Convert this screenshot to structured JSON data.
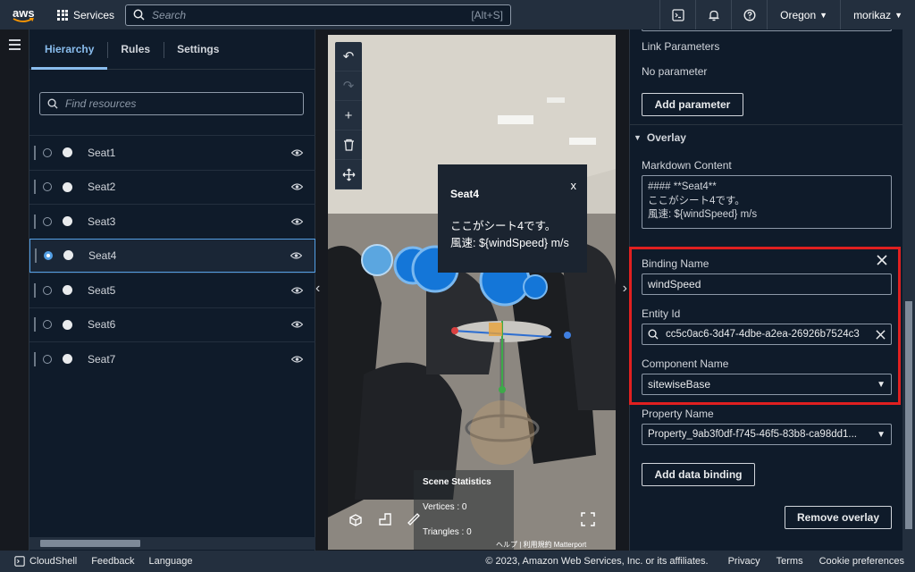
{
  "topbar": {
    "logo": "aws",
    "services_label": "Services",
    "search_placeholder": "Search",
    "search_shortcut": "[Alt+S]",
    "region": "Oregon",
    "user": "morikaz"
  },
  "hierarchy": {
    "tabs": [
      {
        "label": "Hierarchy",
        "active": true
      },
      {
        "label": "Rules",
        "active": false
      },
      {
        "label": "Settings",
        "active": false
      }
    ],
    "find_placeholder": "Find resources",
    "items": [
      {
        "label": "Seat1",
        "selected": false
      },
      {
        "label": "Seat2",
        "selected": false
      },
      {
        "label": "Seat3",
        "selected": false
      },
      {
        "label": "Seat4",
        "selected": true
      },
      {
        "label": "Seat5",
        "selected": false
      },
      {
        "label": "Seat6",
        "selected": false
      },
      {
        "label": "Seat7",
        "selected": false
      }
    ]
  },
  "viewer": {
    "popup": {
      "title": "Seat4",
      "close": "x",
      "line1": "ここがシート4です。",
      "line2": "風速: ${windSpeed} m/s"
    },
    "stats": {
      "title": "Scene Statistics",
      "vertices": "Vertices : 0",
      "triangles": "Triangles : 0"
    },
    "matterport": "ヘルプ | 利用規約  Matterport"
  },
  "properties": {
    "link_parameters_label": "Link Parameters",
    "no_parameter": "No parameter",
    "add_parameter": "Add parameter",
    "overlay_section": "Overlay",
    "markdown_label": "Markdown Content",
    "markdown_value": "#### **Seat4**\nここがシート4です。\n風速: ${windSpeed} m/s",
    "binding_name_label": "Binding Name",
    "binding_name_value": "windSpeed",
    "entity_id_label": "Entity Id",
    "entity_id_value": "cc5c0ac6-3d47-4dbe-a2ea-26926b7524c3",
    "component_name_label": "Component Name",
    "component_name_value": "sitewiseBase",
    "property_name_label": "Property Name",
    "property_name_value": "Property_9ab3f0df-f745-46f5-83b8-ca98dd1...",
    "add_data_binding": "Add data binding",
    "remove_overlay": "Remove overlay"
  },
  "footer": {
    "cloudshell": "CloudShell",
    "feedback": "Feedback",
    "language": "Language",
    "copyright": "© 2023, Amazon Web Services, Inc. or its affiliates.",
    "privacy": "Privacy",
    "terms": "Terms",
    "cookie": "Cookie preferences"
  },
  "colors": {
    "accent": "#89bdee",
    "highlight_box": "#e02020",
    "header_bg": "#232f3e",
    "panel_bg": "#0f1b2a"
  }
}
